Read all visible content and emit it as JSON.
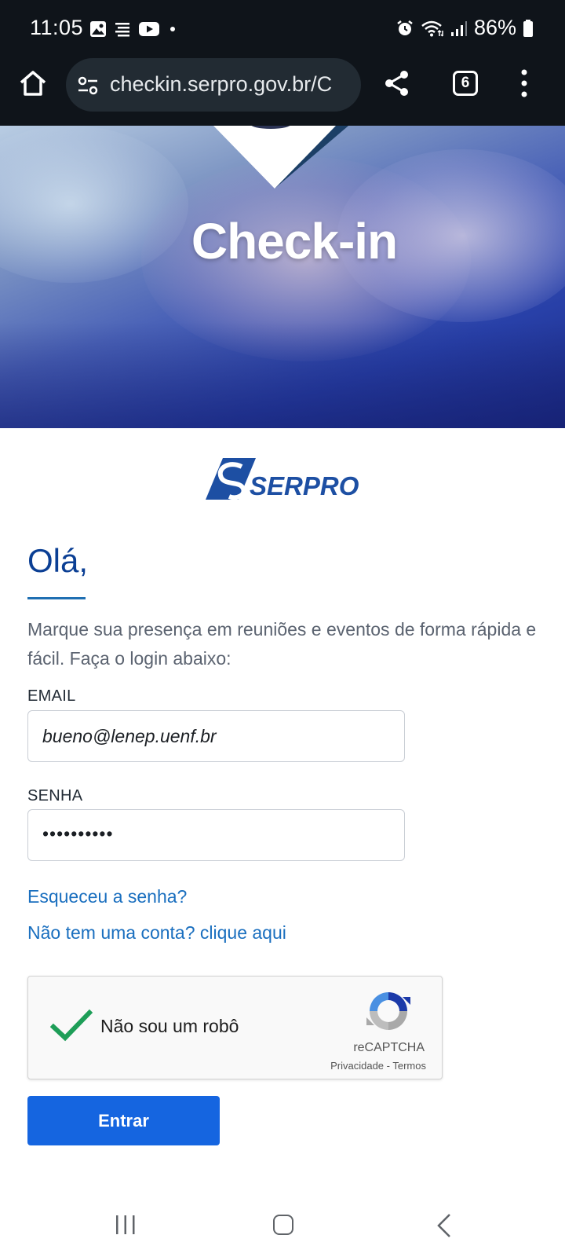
{
  "status_bar": {
    "time": "11:05",
    "battery": "86%",
    "icons_left": [
      "gallery-icon",
      "notes-icon",
      "youtube-icon",
      "dot-icon"
    ],
    "icons_right": [
      "alarm-icon",
      "wifi-icon",
      "signal-icon",
      "battery-icon"
    ]
  },
  "browser": {
    "url": "checkin.serpro.gov.br/C",
    "tab_count": "6"
  },
  "hero": {
    "title": "Check-in"
  },
  "logo": {
    "text": "SERPRO"
  },
  "form": {
    "greeting": "Olá,",
    "intro": "Marque sua presença em reuniões e eventos de forma rápida e fácil. Faça o login abaixo:",
    "email_label": "EMAIL",
    "email_value": "bueno@lenep.uenf.br",
    "password_label": "SENHA",
    "password_value": "••••••••••",
    "forgot_link": "Esqueceu a senha?",
    "signup_link": "Não tem uma conta? clique aqui",
    "submit_label": "Entrar"
  },
  "captcha": {
    "label": "Não sou um robô",
    "brand": "reCAPTCHA",
    "privacy": "Privacidade",
    "separator": " - ",
    "terms": "Termos"
  },
  "colors": {
    "primary_blue": "#1565e0",
    "link_blue": "#1a6fbf",
    "heading_blue": "#0b3f94",
    "check_green": "#1e9e58",
    "status_bg": "#0f141a"
  }
}
